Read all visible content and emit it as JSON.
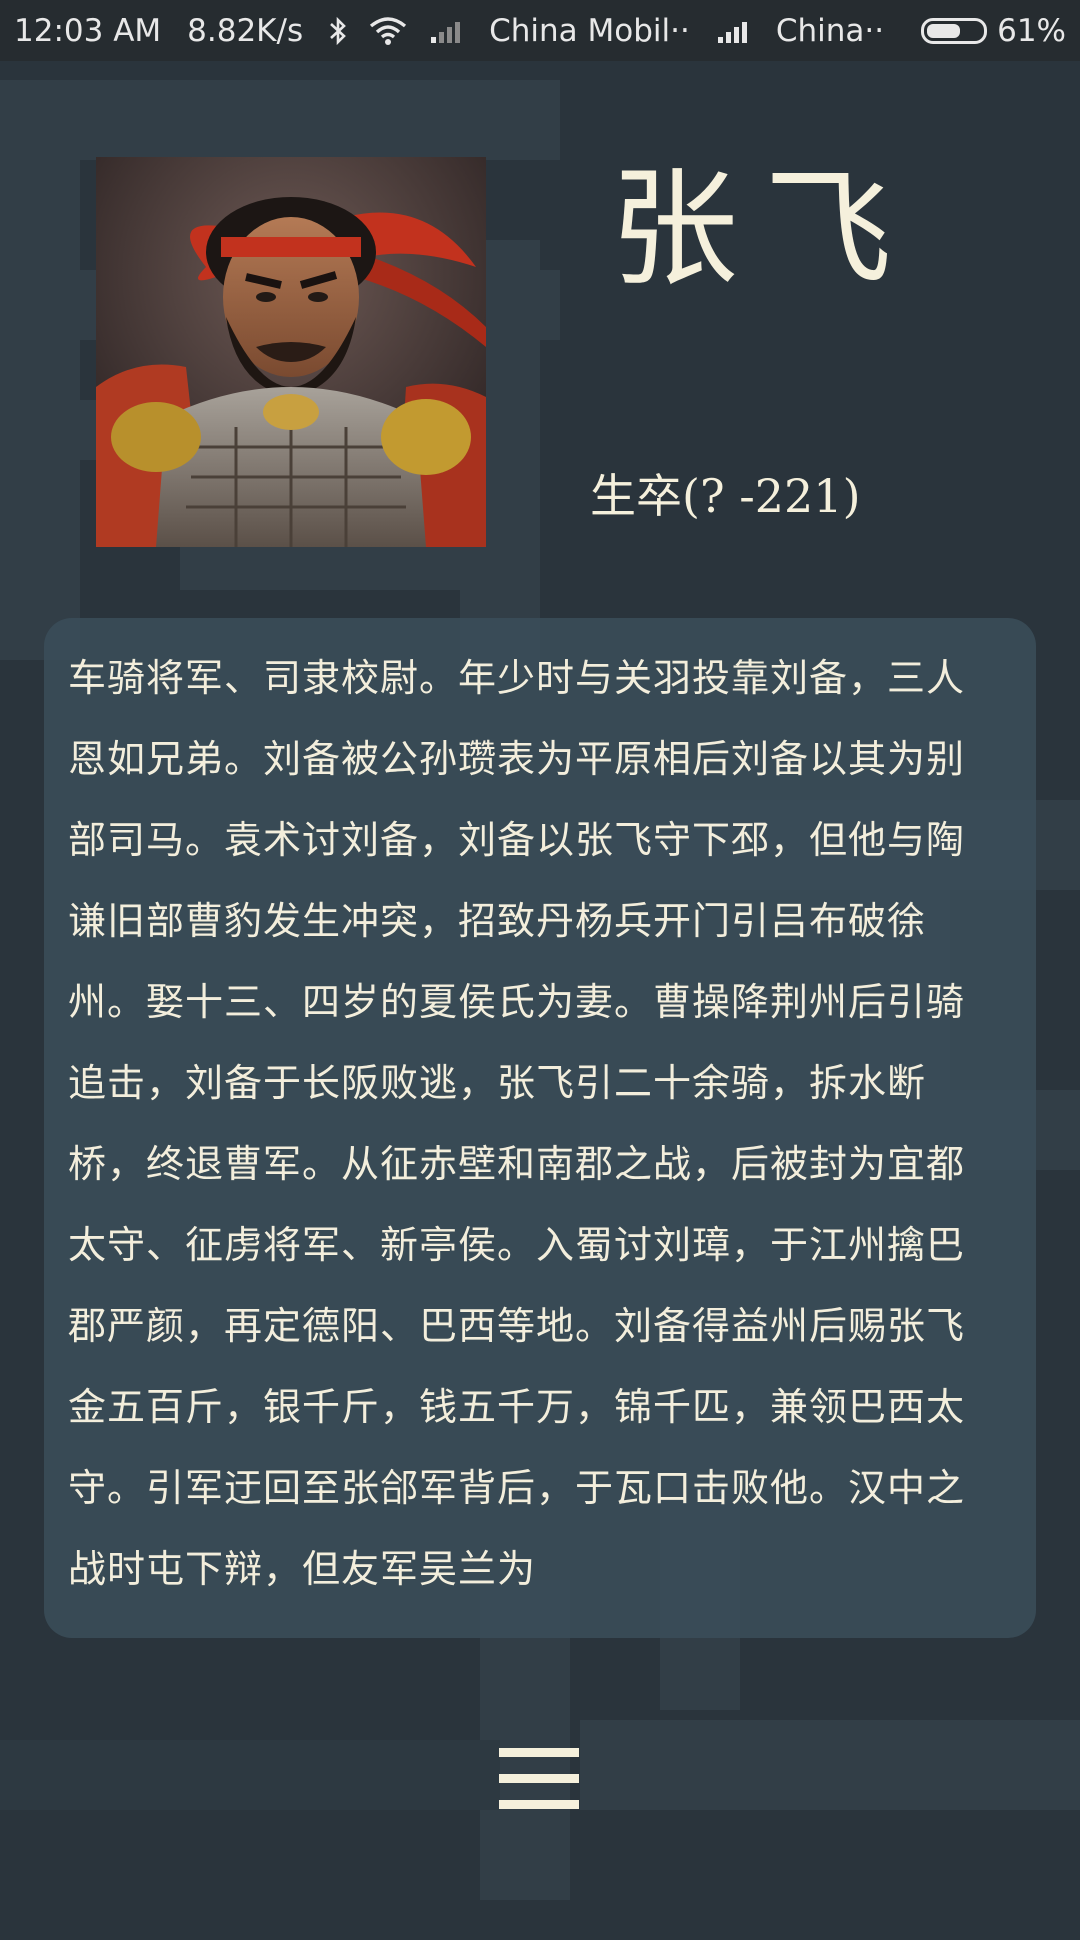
{
  "status_bar": {
    "time": "12:03 AM",
    "network_speed": "8.82K/s",
    "carrier_1": "China Mobil··",
    "carrier_2": "China··",
    "battery_percent": "61%",
    "battery_level": 0.61,
    "icons": [
      "bluetooth-icon",
      "wifi-icon",
      "signal-icon",
      "signal-icon",
      "battery-icon"
    ]
  },
  "profile": {
    "name": "张飞",
    "lifespan": "生卒(?   -221)",
    "portrait_alt": "portrait"
  },
  "bio": {
    "text": "车骑将军、司隶校尉。年少时与关羽投靠刘备，三人恩如兄弟。刘备被公孙瓒表为平原相后刘备以其为别部司马。袁术讨刘备，刘备以张飞守下邳，但他与陶谦旧部曹豹发生冲突，招致丹杨兵开门引吕布破徐州。娶十三、四岁的夏侯氏为妻。曹操降荆州后引骑追击，刘备于长阪败逃，张飞引二十余骑，拆水断桥，终退曹军。从征赤壁和南郡之战，后被封为宜都太守、征虏将军、新亭侯。入蜀讨刘璋，于江州擒巴郡严颜，再定德阳、巴西等地。刘备得益州后赐张飞金五百斤，银千斤，钱五千万，锦千匹，兼领巴西太守。引军迂回至张郃军背后，于瓦口击败他。汉中之战时屯下辩，但友军吴兰为"
  },
  "menu": {
    "icon": "hamburger-menu-icon"
  },
  "colors": {
    "background": "#2a343c",
    "status_bar": "#262c30",
    "card": "#3a4e5a",
    "text": "#f3eedc"
  }
}
